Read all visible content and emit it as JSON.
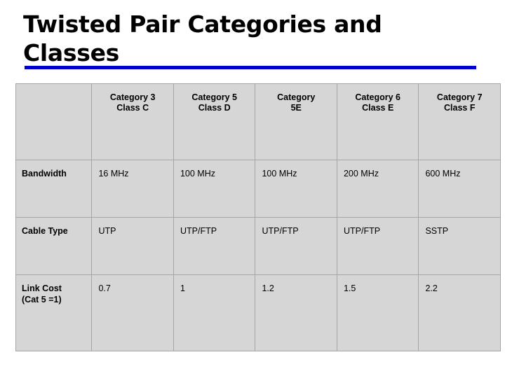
{
  "slide": {
    "title": "Twisted Pair Categories and Classes",
    "accent_color": "#0000cc",
    "cell_background": "#d6d6d6",
    "border_color": "#a6a6a6"
  },
  "table": {
    "corner_label": "",
    "columns": [
      {
        "line1": "Category 3",
        "line2": "Class C"
      },
      {
        "line1": "Category 5",
        "line2": "Class D"
      },
      {
        "line1": "Category",
        "line2": "5E"
      },
      {
        "line1": "Category 6",
        "line2": "Class E"
      },
      {
        "line1": "Category 7",
        "line2": "Class F"
      }
    ],
    "rows": [
      {
        "label_line1": "Bandwidth",
        "label_line2": "",
        "values": [
          "16 MHz",
          "100 MHz",
          "100 MHz",
          "200 MHz",
          "600 MHz"
        ]
      },
      {
        "label_line1": "Cable Type",
        "label_line2": "",
        "values": [
          "UTP",
          "UTP/FTP",
          "UTP/FTP",
          "UTP/FTP",
          "SSTP"
        ]
      },
      {
        "label_line1": "Link Cost",
        "label_line2": "(Cat 5 =1)",
        "values": [
          "0.7",
          "1",
          "1.2",
          "1.5",
          "2.2"
        ]
      }
    ]
  }
}
